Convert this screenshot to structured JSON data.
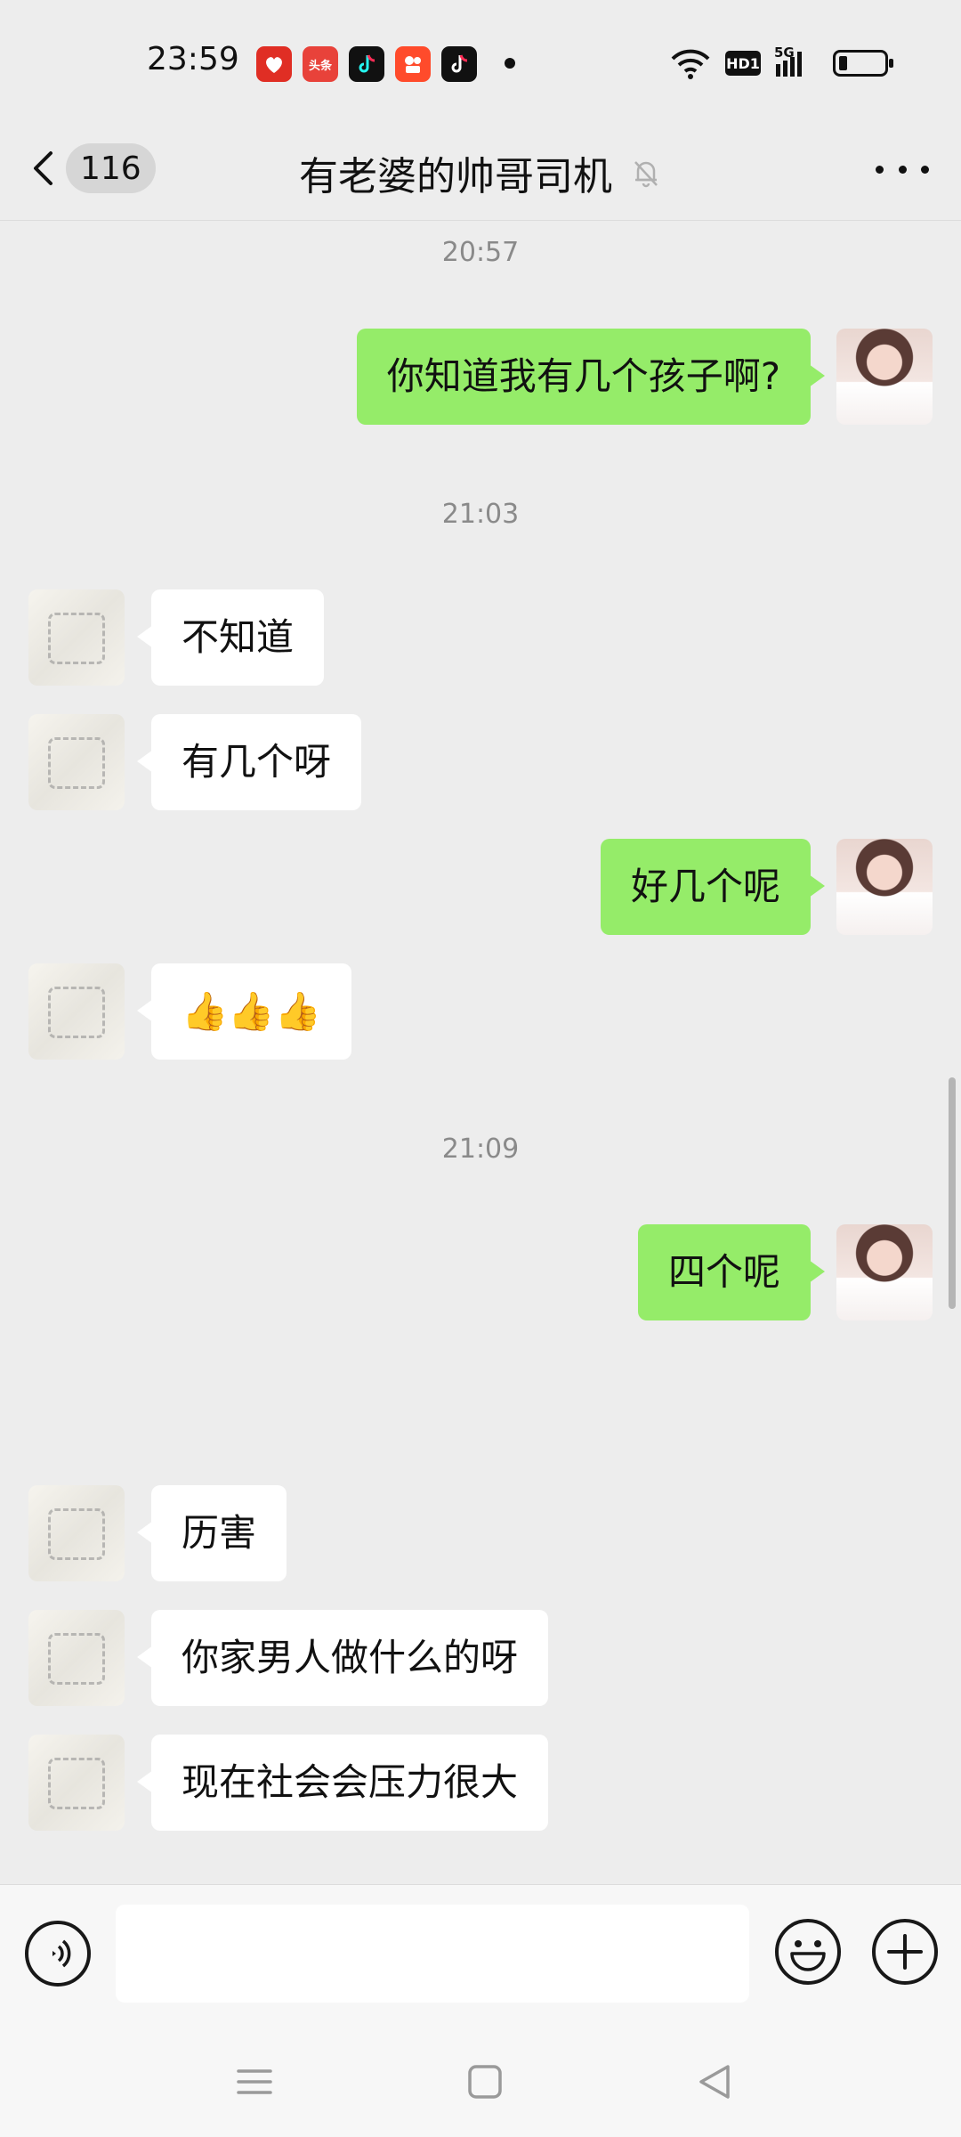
{
  "status_bar": {
    "time": "23:59",
    "app_icons": [
      {
        "name": "pinduoduo-icon",
        "label": "拼多多",
        "color": "#e02e24"
      },
      {
        "name": "toutiao-icon",
        "label": "头条",
        "color": "#e8423a"
      },
      {
        "name": "douyin-lite-icon",
        "label": "",
        "color": "#111111"
      },
      {
        "name": "kuaishou-icon",
        "label": "",
        "color": "#ff4b2b"
      },
      {
        "name": "douyin-icon",
        "label": "",
        "color": "#111111"
      }
    ],
    "hd_label": "HD1",
    "network": "5G"
  },
  "header": {
    "unread_count": "116",
    "title": "有老婆的帅哥司机"
  },
  "messages": [
    {
      "type": "time",
      "text": "20:57"
    },
    {
      "type": "sent",
      "text": "你知道我有几个孩子啊?"
    },
    {
      "type": "time",
      "text": "21:03"
    },
    {
      "type": "recv",
      "text": "不知道"
    },
    {
      "type": "recv",
      "text": "有几个呀"
    },
    {
      "type": "sent",
      "text": "好几个呢"
    },
    {
      "type": "recv",
      "text": "👍👍👍"
    },
    {
      "type": "time",
      "text": "21:09"
    },
    {
      "type": "sent",
      "text": "四个呢"
    },
    {
      "type": "recv",
      "text": "历害"
    },
    {
      "type": "recv",
      "text": "你家男人做什么的呀"
    },
    {
      "type": "recv",
      "text": "现在社会会压力很大"
    }
  ],
  "input": {
    "value": "",
    "placeholder": ""
  },
  "colors": {
    "sent_bubble": "#95ec69",
    "recv_bubble": "#ffffff",
    "background": "#ededed"
  }
}
